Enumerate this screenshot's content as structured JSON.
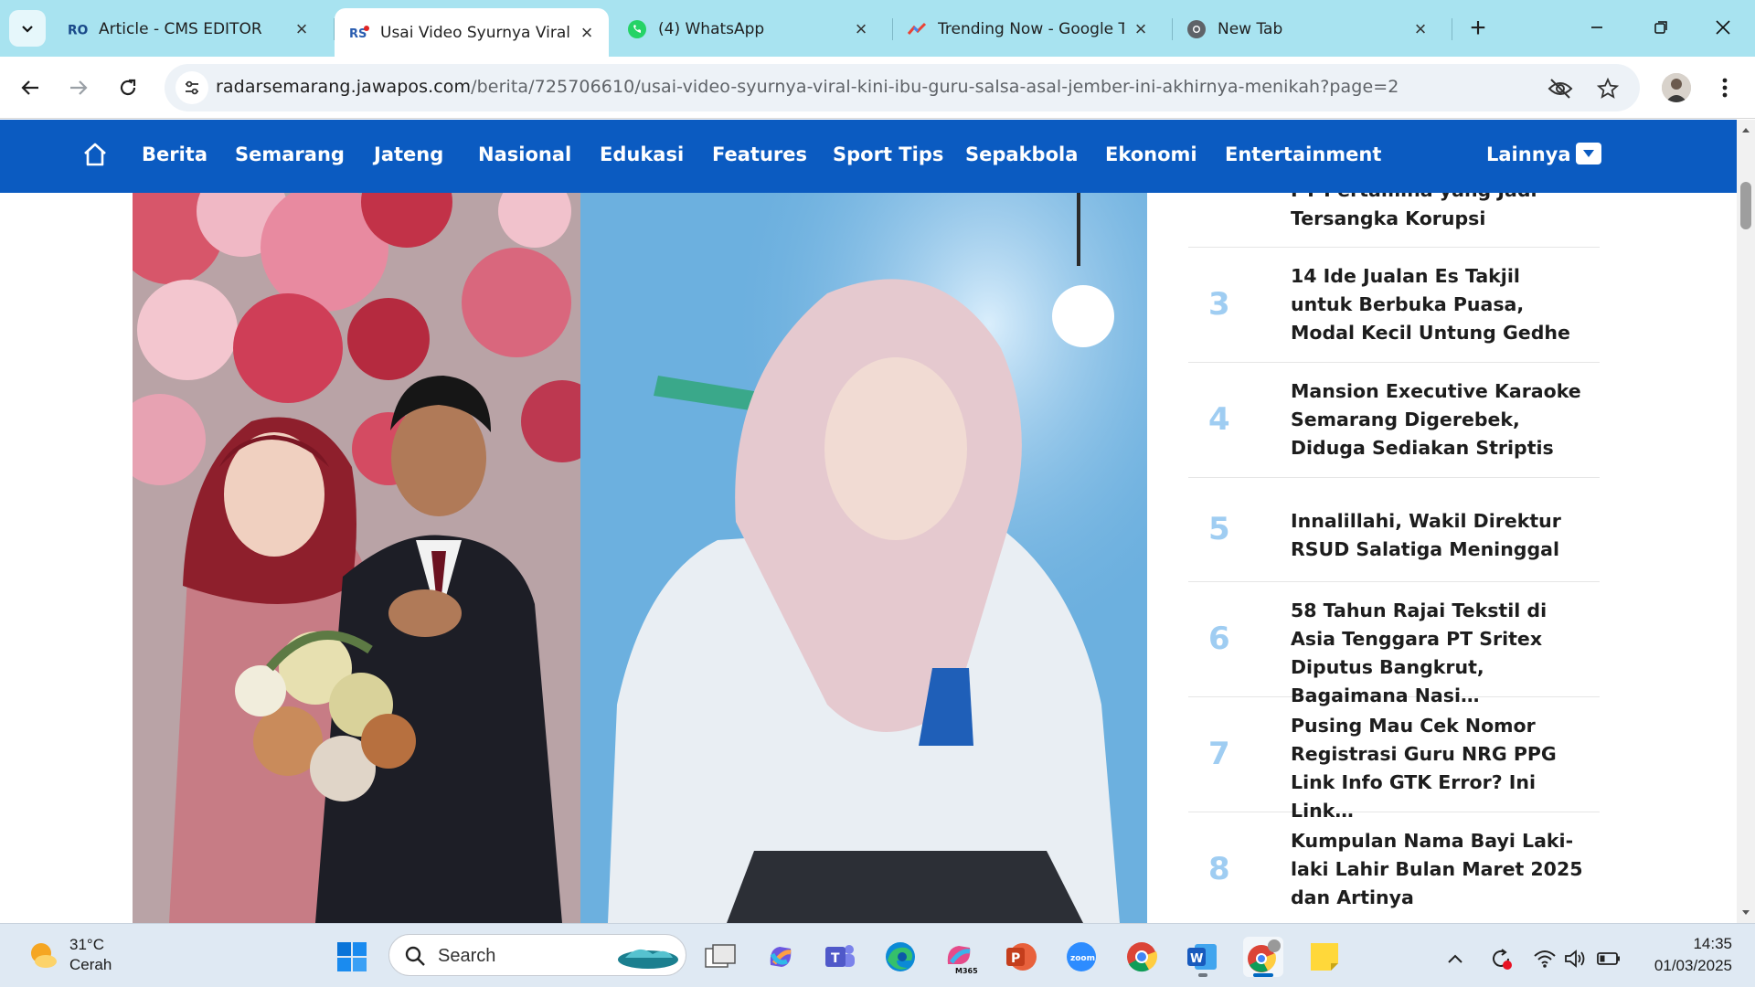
{
  "browser": {
    "tabs": [
      {
        "title": "Article - CMS EDITOR",
        "favicon": "cms-favicon"
      },
      {
        "title": "Usai Video Syurnya Viral,",
        "favicon": "radar-favicon",
        "active": true
      },
      {
        "title": "(4) WhatsApp",
        "favicon": "whatsapp-favicon"
      },
      {
        "title": "Trending Now - Google T",
        "favicon": "trends-favicon"
      },
      {
        "title": "New Tab",
        "favicon": "chrome-favicon"
      }
    ],
    "url_host": "radarsemarang.jawapos.com",
    "url_path": "/berita/725706610/usai-video-syurnya-viral-kini-ibu-guru-salsa-asal-jember-ini-akhirnya-menikah?page=2"
  },
  "site_nav": {
    "items": [
      "Berita",
      "Semarang",
      "Jateng",
      "Nasional",
      "Edukasi",
      "Features",
      "Sport Tips",
      "Sepakbola",
      "Ekonomi",
      "Entertainment"
    ],
    "more_label": "Lainnya",
    "color": "#0b5bc1"
  },
  "popular": {
    "partial_title": "PT Pertamina yang Jadi Tersangka Korupsi",
    "items": [
      {
        "num": "3",
        "title": "14 Ide Jualan Es Takjil untuk Berbuka Puasa, Modal Kecil Untung Gedhe"
      },
      {
        "num": "4",
        "title": "Mansion Executive Karaoke Semarang Digerebek, Diduga Sediakan Striptis"
      },
      {
        "num": "5",
        "title": "Innalillahi, Wakil Direktur RSUD Salatiga Meninggal"
      },
      {
        "num": "6",
        "title": "58 Tahun Rajai Tekstil di Asia Tenggara PT Sritex Diputus Bangkrut, Bagaimana Nasi…"
      },
      {
        "num": "7",
        "title": "Pusing Mau Cek Nomor Registrasi Guru NRG PPG Link Info GTK Error? Ini Link…"
      },
      {
        "num": "8",
        "title": "Kumpulan Nama Bayi Laki-laki Lahir Bulan Maret 2025 dan Artinya"
      }
    ]
  },
  "taskbar": {
    "weather_temp": "31°C",
    "weather_cond": "Cerah",
    "search_label": "Search",
    "time": "14:35",
    "date": "01/03/2025"
  }
}
